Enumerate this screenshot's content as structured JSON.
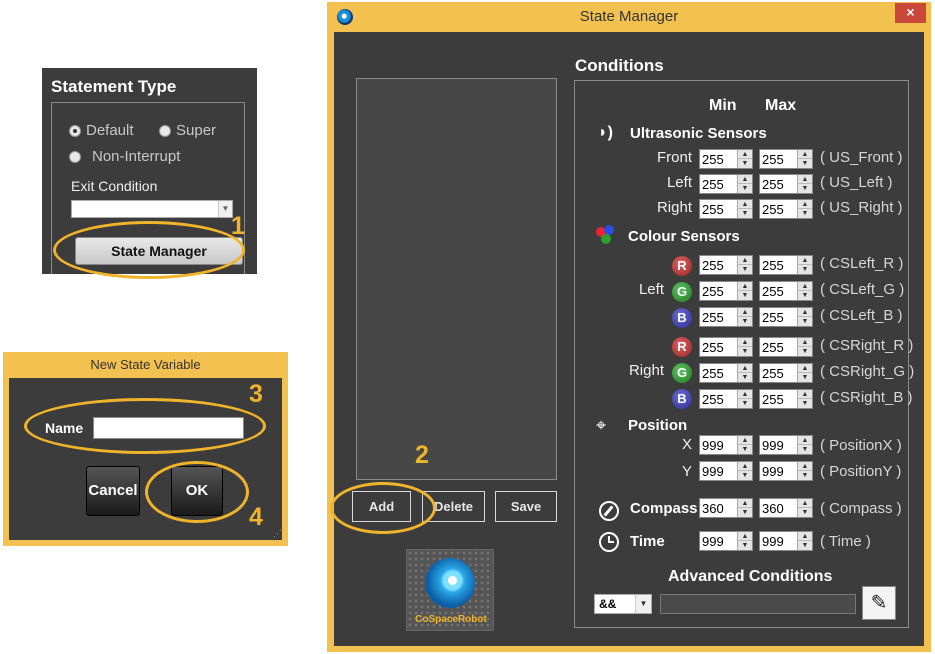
{
  "statement_panel": {
    "title": "Statement Type",
    "radio_default": "Default",
    "radio_super": "Super",
    "radio_noninterrupt": "Non-Interrupt",
    "exit_condition_label": "Exit Condition",
    "exit_condition_value": "",
    "state_manager_button": "State Manager"
  },
  "callouts": {
    "n1": "1",
    "n2": "2",
    "n3": "3",
    "n4": "4"
  },
  "new_state_variable": {
    "title": "New State Variable",
    "name_label": "Name",
    "name_value": "",
    "cancel": "Cancel",
    "ok": "OK"
  },
  "state_manager": {
    "title": "State Manager",
    "close": "×",
    "buttons": {
      "add": "Add",
      "delete": "Delete",
      "save": "Save"
    },
    "logo_text": "CoSpaceRobot",
    "conditions": {
      "title": "Conditions",
      "min_header": "Min",
      "max_header": "Max",
      "ultrasonic": {
        "title": "Ultrasonic Sensors",
        "rows": [
          {
            "label": "Front",
            "min": "255",
            "max": "255",
            "tag": "( US_Front )"
          },
          {
            "label": "Left",
            "min": "255",
            "max": "255",
            "tag": "( US_Left )"
          },
          {
            "label": "Right",
            "min": "255",
            "max": "255",
            "tag": "( US_Right )"
          }
        ]
      },
      "colour": {
        "title": "Colour Sensors",
        "left_label": "Left",
        "right_label": "Right",
        "rows": [
          {
            "ball": "R",
            "min": "255",
            "max": "255",
            "tag": "( CSLeft_R )"
          },
          {
            "ball": "G",
            "min": "255",
            "max": "255",
            "tag": "( CSLeft_G )"
          },
          {
            "ball": "B",
            "min": "255",
            "max": "255",
            "tag": "( CSLeft_B )"
          },
          {
            "ball": "R",
            "min": "255",
            "max": "255",
            "tag": "( CSRight_R )"
          },
          {
            "ball": "G",
            "min": "255",
            "max": "255",
            "tag": "( CSRight_G )"
          },
          {
            "ball": "B",
            "min": "255",
            "max": "255",
            "tag": "( CSRight_B )"
          }
        ]
      },
      "position": {
        "title": "Position",
        "rows": [
          {
            "label": "X",
            "min": "999",
            "max": "999",
            "tag": "( PositionX )"
          },
          {
            "label": "Y",
            "min": "999",
            "max": "999",
            "tag": "( PositionY )"
          }
        ]
      },
      "compass": {
        "title": "Compass",
        "min": "360",
        "max": "360",
        "tag": "( Compass )"
      },
      "time": {
        "title": "Time",
        "min": "999",
        "max": "999",
        "tag": "( Time )"
      },
      "advanced": {
        "title": "Advanced Conditions",
        "operator": "&&",
        "expression": ""
      }
    }
  },
  "colors": {
    "accent_highlight": "#f0b42a",
    "panel_bg": "#3c3c3c",
    "window_frame": "#f3c14f"
  }
}
